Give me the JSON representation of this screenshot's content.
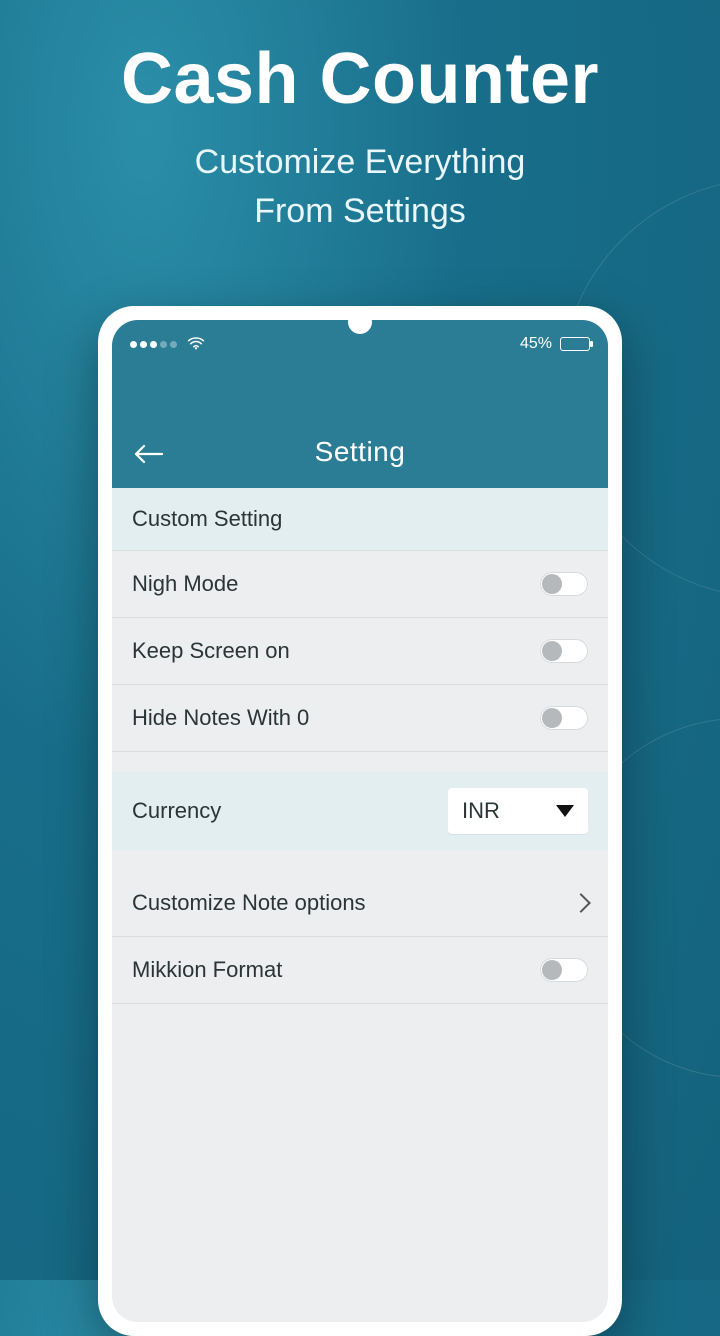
{
  "hero": {
    "title": "Cash Counter",
    "subtitle_line1": "Customize Everything",
    "subtitle_line2": "From Settings"
  },
  "status": {
    "battery_pct": "45%"
  },
  "header": {
    "title": "Setting"
  },
  "sections": {
    "custom_setting": "Custom Setting"
  },
  "rows": {
    "night_mode": "Nigh Mode",
    "keep_screen_on": "Keep Screen on",
    "hide_notes_zero": "Hide Notes With 0",
    "currency_label": "Currency",
    "currency_value": "INR",
    "customize_note_options": "Customize Note options",
    "million_format": "Mikkion Format"
  },
  "toggles": {
    "night_mode": false,
    "keep_screen_on": false,
    "hide_notes_zero": false,
    "million_format": false
  }
}
